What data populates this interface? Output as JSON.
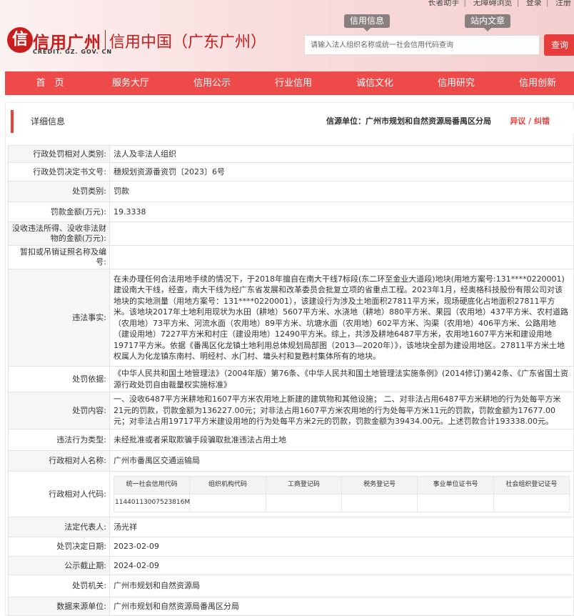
{
  "toplinks": [
    "长者助手",
    "无障碍浏览",
    "登录",
    "注册"
  ],
  "logo": {
    "glyph": "信",
    "main": "信用广州",
    "sub": "CREDIT. GZ. GOV. CN",
    "right": "信用中国（广东广州）"
  },
  "quick_tabs": [
    "信用信息",
    "站内文章"
  ],
  "search": {
    "placeholder": "请输入法人组织名称或统一社会信用代码查询",
    "button": "查询"
  },
  "nav": [
    "首　页",
    "服务大厅",
    "信用公示",
    "行业信用",
    "诚信文化",
    "信用研究",
    "信用创新"
  ],
  "info": {
    "title": "详细信息",
    "source": "信源单位：广州市规划和自然资源局番禺区分局",
    "appeal": "异议 / 纠错"
  },
  "rows": [
    {
      "label": "行政处罚相对人类别:",
      "value": "法人及非法人组织"
    },
    {
      "label": "行政处罚决定书文号:",
      "value": "穗规划资源番资罚〔2023〕6号"
    },
    {
      "label": "处罚类别:",
      "value": "罚款"
    },
    {
      "label": "罚款金额(万元):",
      "value": "19.3338"
    },
    {
      "label": "没收违法所得、没收非法财物的金额(万元):",
      "value": ""
    },
    {
      "label": "暂扣或吊销证照名称及编号:",
      "value": ""
    },
    {
      "label": "违法事实:",
      "value": "在未办理任何合法用地手续的情况下，于2018年擅自在南大干线7标段(东二环至金业大道段)地块(用地方案号:131****0220001)建设南大干线，经查，南大干线为经广东省发展和改革委员会批复立项的省重点工程。2023年1月，经奥格科技股份有限公司对该地块的实地测量（用地方案号：131****0220001），该建设行为涉及土地面积27811平方米，现场硬底化占地面积27811平方米。该地块2017年土地利用现状为水田（耕地）5607平方米、水浇地（耕地）880平方米、果园（农用地）437平方米、农村道路（农用地）73平方米、河流水面（农用地）89平方米、坑塘水面（农用地）602平方米、沟渠（农用地）406平方米、公路用地（建设用地）7227平方米和村庄（建设用地）12490平方米。综上，共涉及耕地6487平方米，农用地1607平方米和建设用地19717平方米。依据《番禺区化龙镇土地利用总体规划局部图（2013—2020年）》，该地块全部为建设用地区。27811平方米土地权属人为化龙镇东南村、明经村、水门村、墉头村和复甦村集体所有的地块。"
    },
    {
      "label": "处罚依据:",
      "value": "《中华人民共和国土地管理法》（2004年版）第76条、《中华人民共和国土地管理法实施条例》(2014修订)第42条、《广东省国土资源行政处罚自由裁量权实施标准》"
    },
    {
      "label": "处罚内容:",
      "value": "一、没收6487平方米耕地和1607平方米农用地上新建的建筑物和其他设施； 二、对非法占用6487平方米耕地的行为处每平方米21元的罚款，罚款金额为136227.00元；对非法占用1607平方米农用地的行为处每平方米11元的罚款，罚款金额为17677.00元；对非法占用19717平方米建设用地的行为处每平方米2元的罚款，罚款金额为39434.00元。上述罚款合计193338.00元。"
    },
    {
      "label": "违法行为类型:",
      "value": "未经批准或者采取欺骗手段骗取批准违法占用土地"
    },
    {
      "label": "行政相对人名称:",
      "value": "广州市番禺区交通运输局"
    },
    {
      "label": "行政相对人代码:",
      "value": ""
    },
    {
      "label": "法定代表人:",
      "value": "汤光祥"
    },
    {
      "label": "处罚决定日期:",
      "value": "2023-02-09"
    },
    {
      "label": "公示截止期:",
      "value": "2024-02-09"
    },
    {
      "label": "处罚机关:",
      "value": "广州市规划和自然资源局"
    },
    {
      "label": "数据来源单位:",
      "value": "广州市规划和自然资源局番禺区分局"
    }
  ],
  "codes": {
    "headers": [
      "统一社会信用代码",
      "组织机构代码",
      "工商登记码",
      "税务登记号",
      "事业单位证书号",
      "社会组织登记证号"
    ],
    "values": [
      "11440113007523816M",
      "",
      "",
      "",
      "",
      ""
    ]
  }
}
